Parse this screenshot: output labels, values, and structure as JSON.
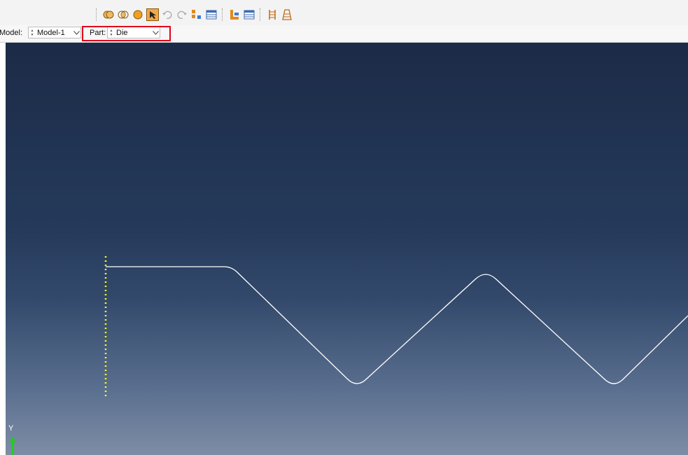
{
  "toolbar": {
    "icons": [
      "union-icon",
      "intersect-icon",
      "sphere-icon",
      "select-icon",
      "undo-icon",
      "redo-icon",
      "tree-icon",
      "table-icon",
      "assembly-icon",
      "table2-icon",
      "ladder-icon",
      "stack-icon"
    ]
  },
  "context_bar": {
    "model_label": "Model:",
    "model_value": "Model-1",
    "part_label": "Part:",
    "part_value": "Die"
  },
  "viewport": {
    "triad_label": "Y",
    "profile_color": "#ffffff",
    "constraint_color": "#ffff00",
    "triad_color": "#22cc22"
  }
}
